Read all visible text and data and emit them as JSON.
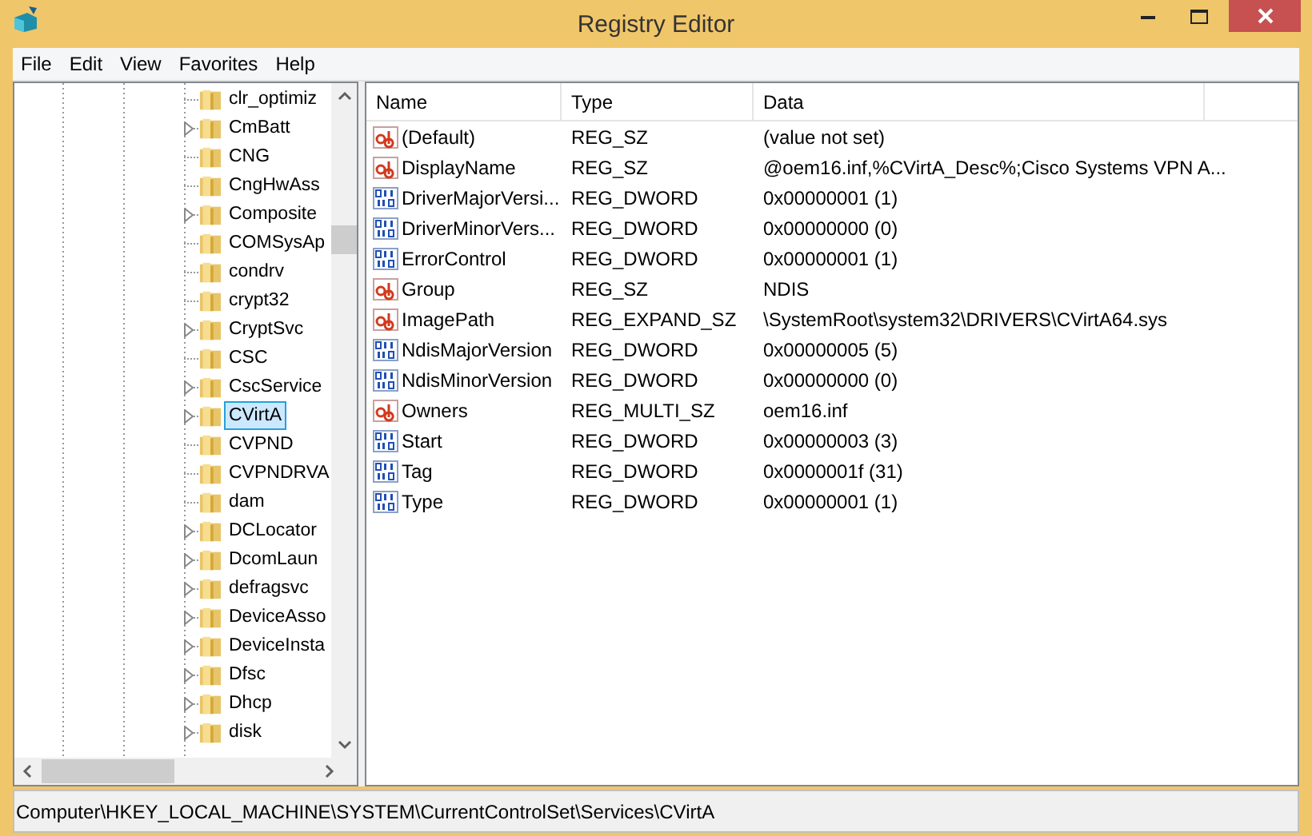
{
  "window": {
    "title": "Registry Editor"
  },
  "menu": [
    "File",
    "Edit",
    "View",
    "Favorites",
    "Help"
  ],
  "tree": {
    "items": [
      {
        "label": "clr_optimiz",
        "expandable": false,
        "selected": false
      },
      {
        "label": "CmBatt",
        "expandable": true,
        "selected": false
      },
      {
        "label": "CNG",
        "expandable": false,
        "selected": false
      },
      {
        "label": "CngHwAss",
        "expandable": false,
        "selected": false
      },
      {
        "label": "Composite",
        "expandable": true,
        "selected": false
      },
      {
        "label": "COMSysAp",
        "expandable": false,
        "selected": false
      },
      {
        "label": "condrv",
        "expandable": false,
        "selected": false
      },
      {
        "label": "crypt32",
        "expandable": false,
        "selected": false
      },
      {
        "label": "CryptSvc",
        "expandable": true,
        "selected": false
      },
      {
        "label": "CSC",
        "expandable": false,
        "selected": false
      },
      {
        "label": "CscService",
        "expandable": true,
        "selected": false
      },
      {
        "label": "CVirtA",
        "expandable": true,
        "selected": true
      },
      {
        "label": "CVPND",
        "expandable": false,
        "selected": false
      },
      {
        "label": "CVPNDRVA",
        "expandable": false,
        "selected": false
      },
      {
        "label": "dam",
        "expandable": false,
        "selected": false
      },
      {
        "label": "DCLocator",
        "expandable": true,
        "selected": false
      },
      {
        "label": "DcomLaun",
        "expandable": true,
        "selected": false
      },
      {
        "label": "defragsvc",
        "expandable": true,
        "selected": false
      },
      {
        "label": "DeviceAsso",
        "expandable": true,
        "selected": false
      },
      {
        "label": "DeviceInsta",
        "expandable": true,
        "selected": false
      },
      {
        "label": "Dfsc",
        "expandable": true,
        "selected": false
      },
      {
        "label": "Dhcp",
        "expandable": true,
        "selected": false
      },
      {
        "label": "disk",
        "expandable": true,
        "selected": false
      }
    ]
  },
  "values": {
    "columns": [
      "Name",
      "Type",
      "Data"
    ],
    "rows": [
      {
        "kind": "string",
        "name": "(Default)",
        "type": "REG_SZ",
        "data": "(value not set)"
      },
      {
        "kind": "string",
        "name": "DisplayName",
        "type": "REG_SZ",
        "data": "@oem16.inf,%CVirtA_Desc%;Cisco Systems VPN A..."
      },
      {
        "kind": "binary",
        "name": "DriverMajorVersi...",
        "type": "REG_DWORD",
        "data": "0x00000001 (1)"
      },
      {
        "kind": "binary",
        "name": "DriverMinorVers...",
        "type": "REG_DWORD",
        "data": "0x00000000 (0)"
      },
      {
        "kind": "binary",
        "name": "ErrorControl",
        "type": "REG_DWORD",
        "data": "0x00000001 (1)"
      },
      {
        "kind": "string",
        "name": "Group",
        "type": "REG_SZ",
        "data": "NDIS"
      },
      {
        "kind": "string",
        "name": "ImagePath",
        "type": "REG_EXPAND_SZ",
        "data": "\\SystemRoot\\system32\\DRIVERS\\CVirtA64.sys"
      },
      {
        "kind": "binary",
        "name": "NdisMajorVersion",
        "type": "REG_DWORD",
        "data": "0x00000005 (5)"
      },
      {
        "kind": "binary",
        "name": "NdisMinorVersion",
        "type": "REG_DWORD",
        "data": "0x00000000 (0)"
      },
      {
        "kind": "string",
        "name": "Owners",
        "type": "REG_MULTI_SZ",
        "data": "oem16.inf"
      },
      {
        "kind": "binary",
        "name": "Start",
        "type": "REG_DWORD",
        "data": "0x00000003 (3)"
      },
      {
        "kind": "binary",
        "name": "Tag",
        "type": "REG_DWORD",
        "data": "0x0000001f (31)"
      },
      {
        "kind": "binary",
        "name": "Type",
        "type": "REG_DWORD",
        "data": "0x00000001 (1)"
      }
    ]
  },
  "status_bar": "Computer\\HKEY_LOCAL_MACHINE\\SYSTEM\\CurrentControlSet\\Services\\CVirtA"
}
